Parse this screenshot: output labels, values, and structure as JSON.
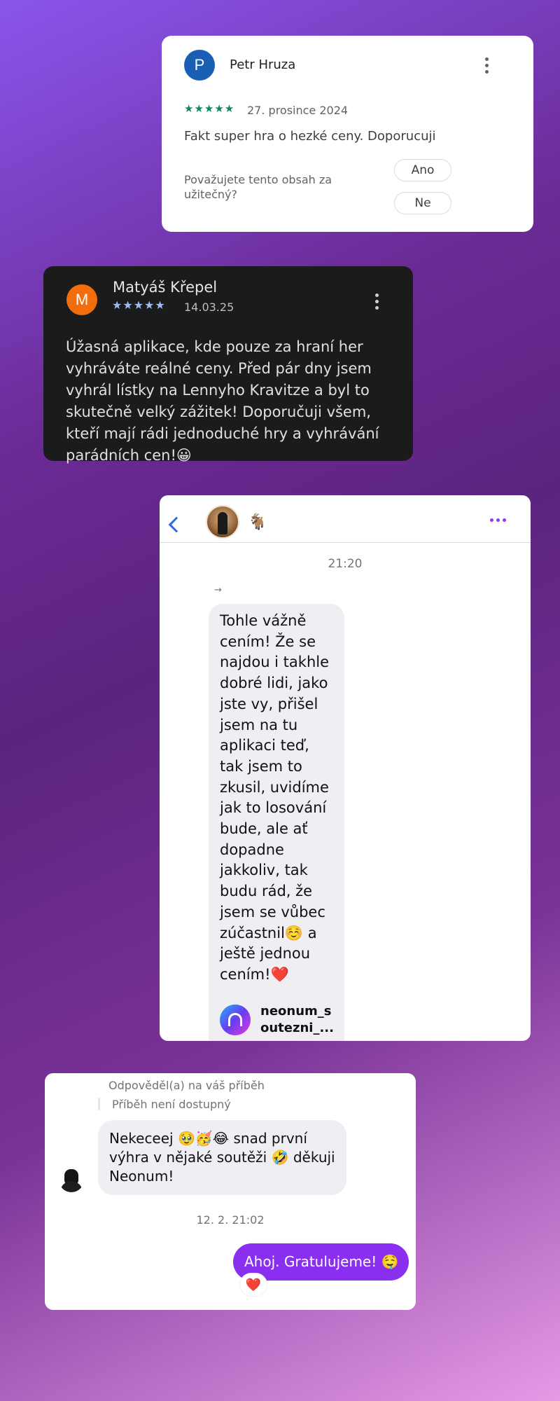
{
  "review_light": {
    "avatar_letter": "P",
    "author": "Petr Hruza",
    "rating": 5,
    "stars": "★★★★★",
    "date": "27. prosince 2024",
    "text": "Fakt super hra o hezké ceny. Doporucuji",
    "helpful_question": "Považujete tento obsah za užitečný?",
    "yes_label": "Ano",
    "no_label": "Ne",
    "accent": "#0b8a5a",
    "avatar_color": "#1a5fb4"
  },
  "review_dark": {
    "avatar_letter": "M",
    "author": "Matyáš Křepel",
    "rating": 5,
    "stars": "★★★★★",
    "date": "14.03.25",
    "text": "Úžasná aplikace, kde pouze za hraní her vyhráváte reálné ceny. Před pár dny jsem vyhrál lístky na Lennyho Kravitze a byl to skutečně velký zážitek!  Doporučuji všem, kteří mají rádi jednoduché hry a vyhrávání parádních cen!😀",
    "avatar_color": "#f26d0c"
  },
  "dm_chat": {
    "contact_emoji": "🐐",
    "time": "21:20",
    "forward_icon": "→",
    "message": "Tohle vážně cením! Že se najdou i takhle dobré lidi, jako jste vy, přišel jsem na tu aplikaci teď, tak jsem to zkusil, uvidíme jak to losování bude, ale ať dopadne jakkoliv, tak budu rád, že jsem se vůbec zúčastnil☺️ a ještě jednou cením!❤️",
    "shared_account": "neonum_soutezni_...",
    "accent": "#8d3cf2"
  },
  "story_reply": {
    "replied_label": "Odpověděl(a) na váš příběh",
    "story_unavailable": "Příběh není dostupný",
    "incoming_message": "Nekeceej 🥹🥳😂 snad první výhra v nějaké soutěži 🤣 děkuji Neonum!",
    "timestamp": "12. 2. 21:02",
    "outgoing_message": "Ahoj. Gratulujeme! 🤤",
    "reaction": "❤️",
    "accent": "#8a2ff0"
  }
}
